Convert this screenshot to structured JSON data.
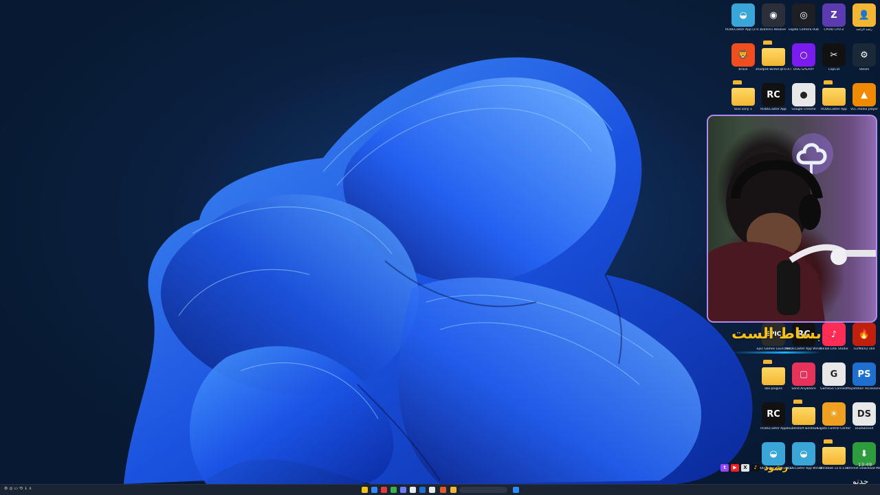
{
  "desktop": {
    "icons_top": [
      {
        "label": "RODECaster App (2.0.111) - نسخة",
        "icon": "disc-app-icon",
        "color": "#3aa6d8"
      },
      {
        "label": "DaVinci Resolve",
        "icon": "davinci-resolve-icon",
        "color": "#2a2f3a"
      },
      {
        "label": "Elgato Camera Hub",
        "icon": "camera-hub-icon",
        "color": "#1d1f24"
      },
      {
        "label": "CPUID CPU-Z",
        "icon": "cpu-z-icon",
        "color": "#5a3bb0"
      },
      {
        "label": "راشد الراشد",
        "icon": "user-folder-icon",
        "color": "#f2b632"
      },
      {
        "label": "Brave",
        "icon": "brave-icon",
        "color": "#f04e1f"
      },
      {
        "label": "shadps4-win64-qt-0.4.0",
        "icon": "folder-icon",
        "color": "#f2b632"
      },
      {
        "label": "DOG GALAXY",
        "icon": "ring-icon",
        "color": "#7a1cf0"
      },
      {
        "label": "CapCut",
        "icon": "capcut-icon",
        "color": "#111111"
      },
      {
        "label": "Steam",
        "icon": "steam-icon",
        "color": "#1b2838"
      },
      {
        "label": "bios sony 1",
        "icon": "folder-icon",
        "color": "#f2b632"
      },
      {
        "label": "RODECaster App",
        "icon": "rode-icon",
        "color": "#111111"
      },
      {
        "label": "Google Chrome",
        "icon": "chrome-icon",
        "color": "#e8e8e8"
      },
      {
        "label": "RODECaster App",
        "icon": "folder-icon",
        "color": "#f2b632"
      },
      {
        "label": "VLC media player",
        "icon": "vlc-icon",
        "color": "#f08a00"
      }
    ],
    "icons_bottom": [
      {
        "label": "Epic Games Launcher",
        "icon": "epic-games-icon",
        "color": "#2b2b2b"
      },
      {
        "label": "RODECaster App Windows v2.0.111",
        "icon": "rode-icon",
        "color": "#111111"
      },
      {
        "label": "TikTok LIVE Studio",
        "icon": "tiktok-live-icon",
        "color": "#ff2d55"
      },
      {
        "label": "FurMark2 x64",
        "icon": "furmark-icon",
        "color": "#c2200f"
      },
      {
        "label": "obs-plugins",
        "icon": "folder-icon",
        "color": "#f2b632"
      },
      {
        "label": "Send Anywhere",
        "icon": "send-anywhere-icon",
        "color": "#e8325a"
      },
      {
        "label": "GameGo Connect",
        "icon": "gamego-icon",
        "color": "#e8e8e8"
      },
      {
        "label": "PlayStation Accessories",
        "icon": "playstation-icon",
        "color": "#1f6fd0"
      },
      {
        "label": "RODECaster App",
        "icon": "rode-icon",
        "color": "#111111"
      },
      {
        "label": "doublestart-windows...",
        "icon": "folder-icon",
        "color": "#f2b632"
      },
      {
        "label": "Elgato Control Center",
        "icon": "control-center-icon",
        "color": "#f0a020"
      },
      {
        "label": "DualSenseX",
        "icon": "dualsense-icon",
        "color": "#e8e8e8"
      },
      {
        "label": "RODECaster App (2.0.111)",
        "icon": "disc-app-icon",
        "color": "#3aa6d8"
      },
      {
        "label": "RODECaster App Windows v2.0.111",
        "icon": "disc-app-icon",
        "color": "#3aa6d8"
      },
      {
        "label": "Windows v2.0.111",
        "icon": "folder-icon",
        "color": "#f2b632"
      },
      {
        "label": "Internet Download Manager",
        "icon": "idm-icon",
        "color": "#2e9b3c"
      }
    ]
  },
  "overlay": {
    "title_text": "بساط الست",
    "handle": "رشود"
  },
  "watermark": "حدنو",
  "clock": {
    "time": "13:49"
  },
  "colors": {
    "accent": "#f6c313",
    "webcam_border": "#b18cf0",
    "wallpaper_blue": "#1e5fe8"
  }
}
